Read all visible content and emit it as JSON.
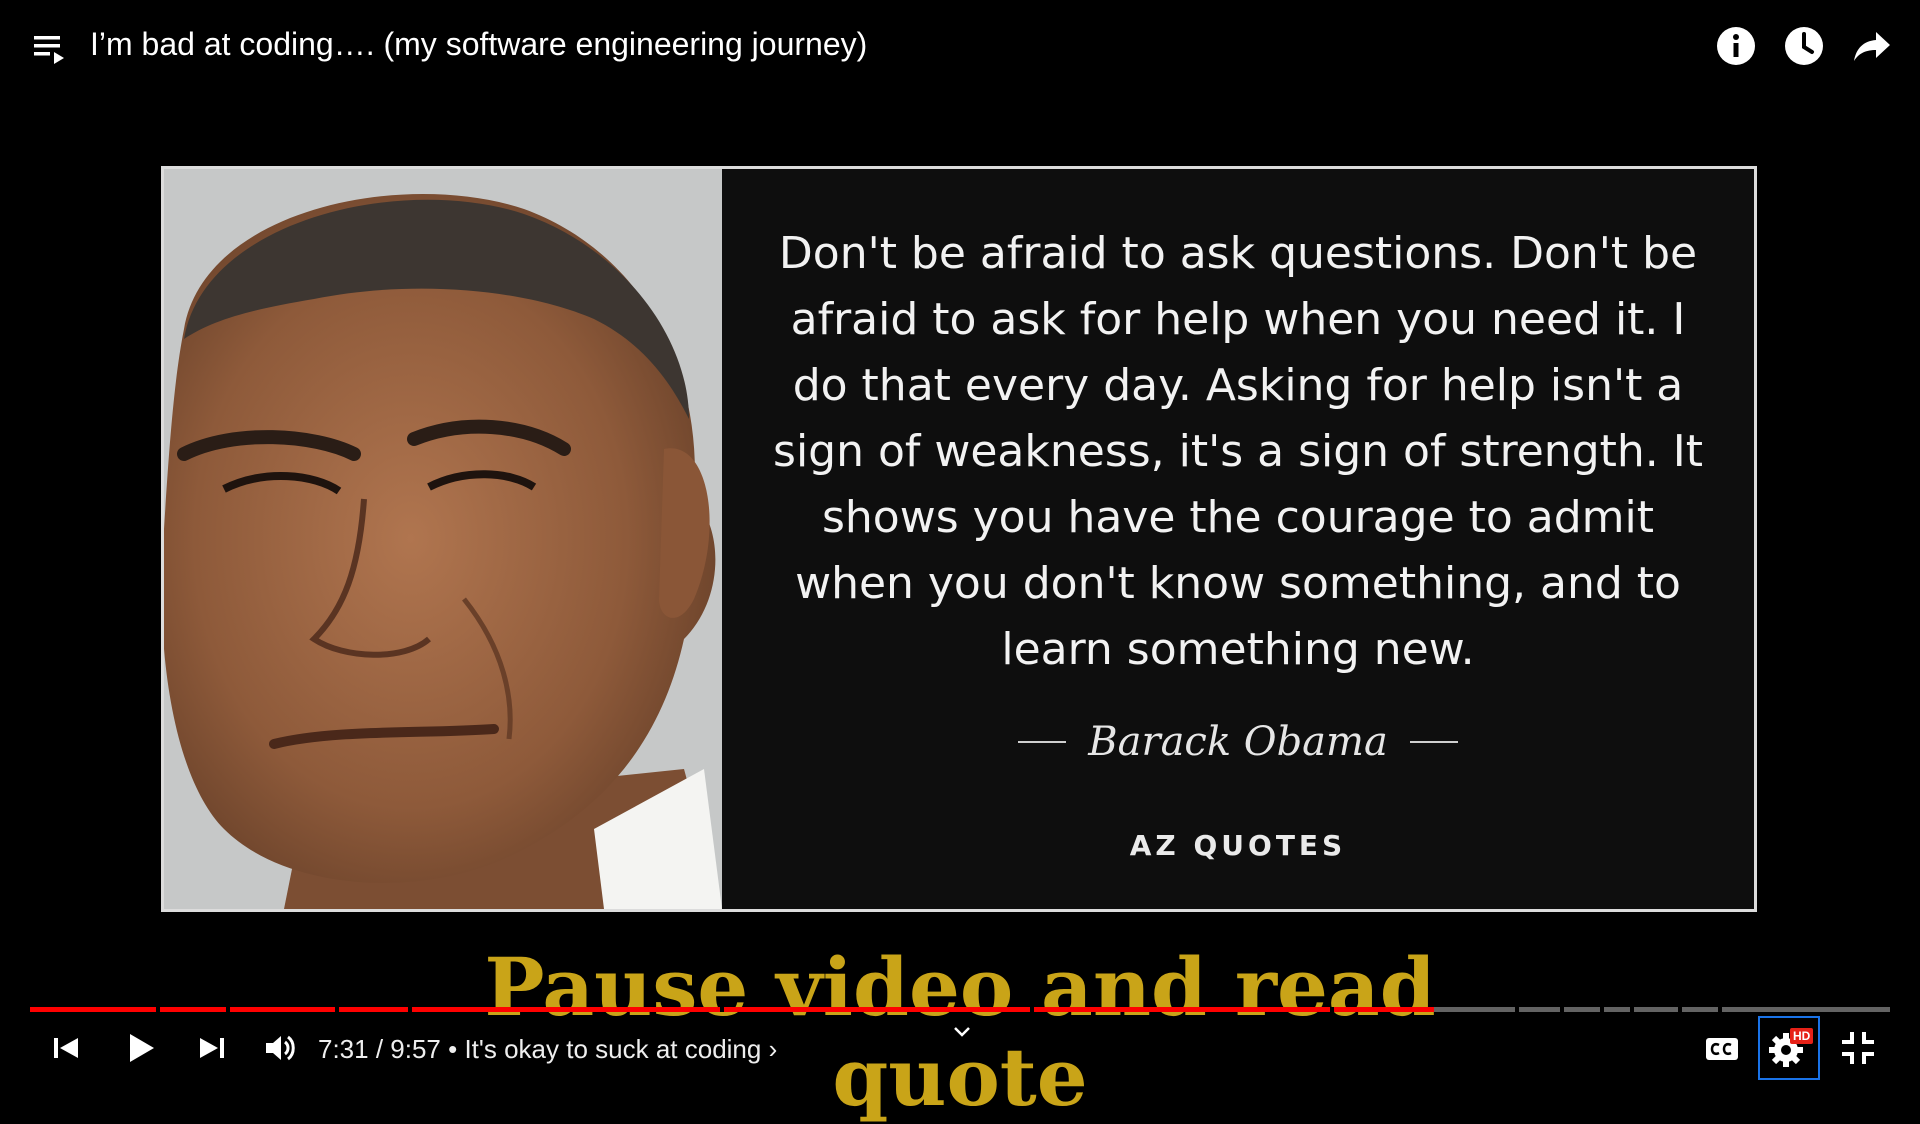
{
  "header": {
    "title": "I’m bad at coding…. (my software engineering journey)",
    "icons": [
      "playlist-icon",
      "info-icon",
      "watch-later-icon",
      "share-icon"
    ]
  },
  "video": {
    "quote": "Don't be afraid to ask questions. Don't be afraid to ask for help when you need it. I do that every day. Asking for help isn't a sign of weakness, it's a sign of strength. It shows you have the courage to admit when you don't know something, and to learn something new.",
    "author": "Barack Obama",
    "brand": "AZ QUOTES",
    "overlay_caption": "Pause video and read quote"
  },
  "player": {
    "current_time": "7:31",
    "separator": " / ",
    "duration": "9:57",
    "chapter_bullet": " • ",
    "chapter_title": "It's okay to suck at coding",
    "chapter_chevron": "›",
    "progress_fraction": 0.755,
    "hd_badge": "HD",
    "accent_color": "#ff0000",
    "caption_color": "#c9a418"
  }
}
